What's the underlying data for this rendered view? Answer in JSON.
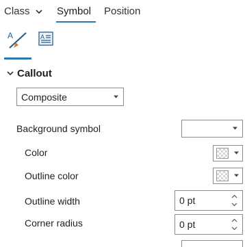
{
  "tabs": [
    {
      "label": "Class",
      "has_dropdown": true,
      "selected": false
    },
    {
      "label": "Symbol",
      "selected": true
    },
    {
      "label": "Position",
      "selected": false
    }
  ],
  "icons": {
    "symbol_tab_icon": "text-symbol-icon",
    "text_props_icon": "text-properties-icon"
  },
  "callout": {
    "header": "Callout",
    "type_value": "Composite",
    "rows": [
      {
        "label": "Background symbol",
        "control": "dropdown",
        "value": ""
      },
      {
        "label": "Color",
        "control": "color-picker"
      },
      {
        "label": "Outline color",
        "control": "color-picker"
      },
      {
        "label": "Outline width",
        "control": "spinner",
        "value": "0 pt"
      },
      {
        "label": "Corner radius",
        "control": "spinner",
        "value": "0 pt"
      }
    ]
  },
  "colors": {
    "accent": "#2a7ab0",
    "icon_orange": "#d9792b"
  }
}
